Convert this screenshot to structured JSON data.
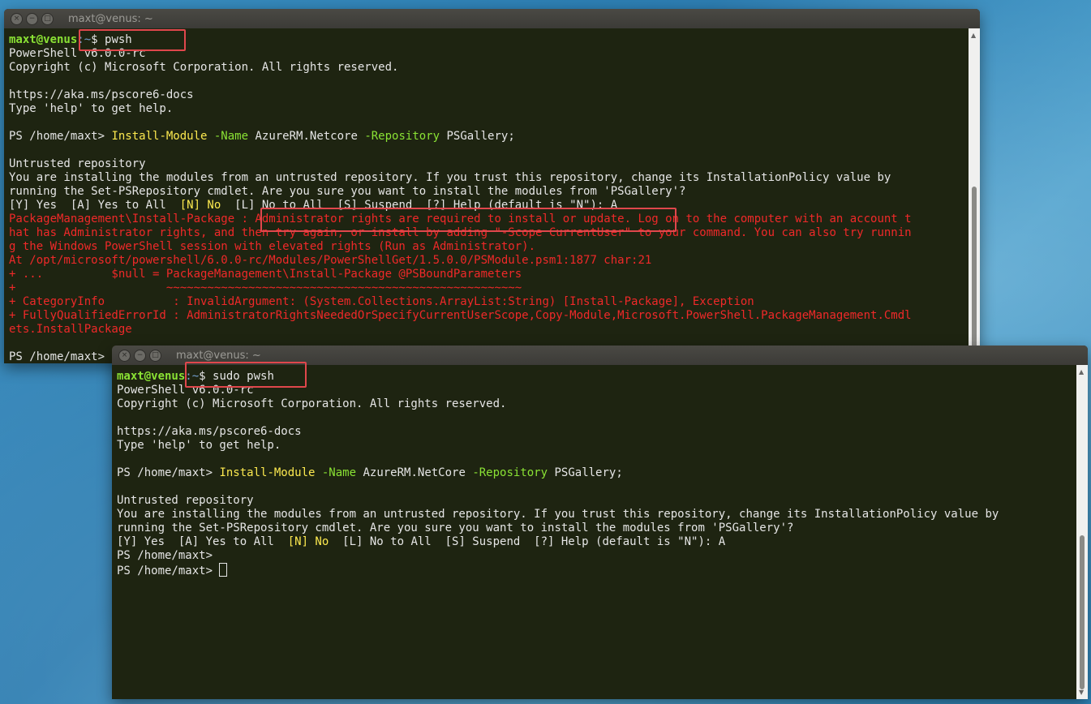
{
  "window1": {
    "title": "maxt@venus: ~",
    "user_host": "maxt@venus",
    "path": ":~",
    "cmd": "$ pwsh",
    "banner1": "PowerShell v6.0.0-rc",
    "banner2": "Copyright (c) Microsoft Corporation. All rights reserved.",
    "docs_url": "https://aka.ms/pscore6-docs",
    "help_line": "Type 'help' to get help.",
    "prompt": "PS /home/maxt> ",
    "cmdlet": "Install-Module",
    "param1": " -Name",
    "arg1": " AzureRM.Netcore",
    "param2": " -Repository",
    "arg2": " PSGallery;",
    "untrusted": "Untrusted repository",
    "warn1": "You are installing the modules from an untrusted repository. If you trust this repository, change its InstallationPolicy value by",
    "warn2": "running the Set-PSRepository cmdlet. Are you sure you want to install the modules from 'PSGallery'?",
    "choice_pre": "[Y] Yes  [A] Yes to All  ",
    "choice_no": "[N] No",
    "choice_post": "  [L] No to All  [S] Suspend  [?] Help (default is \"N\"): A",
    "err1": "PackageManagement\\Install-Package : Administrator rights are required to install or update. Log on to the computer with an account t",
    "err2": "hat has Administrator rights, and then try again, or install by adding \"-Scope CurrentUser\" to your command. You can also try runnin",
    "err3": "g the Windows PowerShell session with elevated rights (Run as Administrator).",
    "err4": "At /opt/microsoft/powershell/6.0.0-rc/Modules/PowerShellGet/1.5.0.0/PSModule.psm1:1877 char:21",
    "err5": "+ ...          $null = PackageManagement\\Install-Package @PSBoundParameters",
    "err6": "+                      ~~~~~~~~~~~~~~~~~~~~~~~~~~~~~~~~~~~~~~~~~~~~~~~~~~~~",
    "err7": "+ CategoryInfo          : InvalidArgument: (System.Collections.ArrayList:String) [Install-Package], Exception",
    "err8": "+ FullyQualifiedErrorId : AdministratorRightsNeededOrSpecifyCurrentUserScope,Copy-Module,Microsoft.PowerShell.PackageManagement.Cmdl",
    "err9": "ets.InstallPackage",
    "last_prompt": "PS /home/maxt>"
  },
  "window2": {
    "title": "maxt@venus: ~",
    "user_host": "maxt@venus",
    "path": ":~",
    "cmd": "$ sudo pwsh",
    "banner1": "PowerShell v6.0.0-rc",
    "banner2": "Copyright (c) Microsoft Corporation. All rights reserved.",
    "docs_url": "https://aka.ms/pscore6-docs",
    "help_line": "Type 'help' to get help.",
    "prompt": "PS /home/maxt> ",
    "cmdlet": "Install-Module",
    "param1": " -Name",
    "arg1": " AzureRM.NetCore",
    "param2": " -Repository",
    "arg2": " PSGallery;",
    "untrusted": "Untrusted repository",
    "warn1": "You are installing the modules from an untrusted repository. If you trust this repository, change its InstallationPolicy value by",
    "warn2": "running the Set-PSRepository cmdlet. Are you sure you want to install the modules from 'PSGallery'?",
    "choice_pre": "[Y] Yes  [A] Yes to All  ",
    "choice_no": "[N] No",
    "choice_post": "  [L] No to All  [S] Suspend  [?] Help (default is \"N\"): A",
    "prompt_after1": "PS /home/maxt>",
    "prompt_after2": "PS /home/maxt> "
  },
  "window_controls": {
    "close_glyph": "×",
    "minimize_glyph": "−",
    "maximize_glyph": "□"
  },
  "colors": {
    "terminal_bg": "#1e2411",
    "highlight_box": "#e0474c",
    "error_text": "#ef2929",
    "cmdlet": "#fce94f",
    "param": "#8ae234",
    "user_host": "#8ae234",
    "path": "#729fcf"
  }
}
